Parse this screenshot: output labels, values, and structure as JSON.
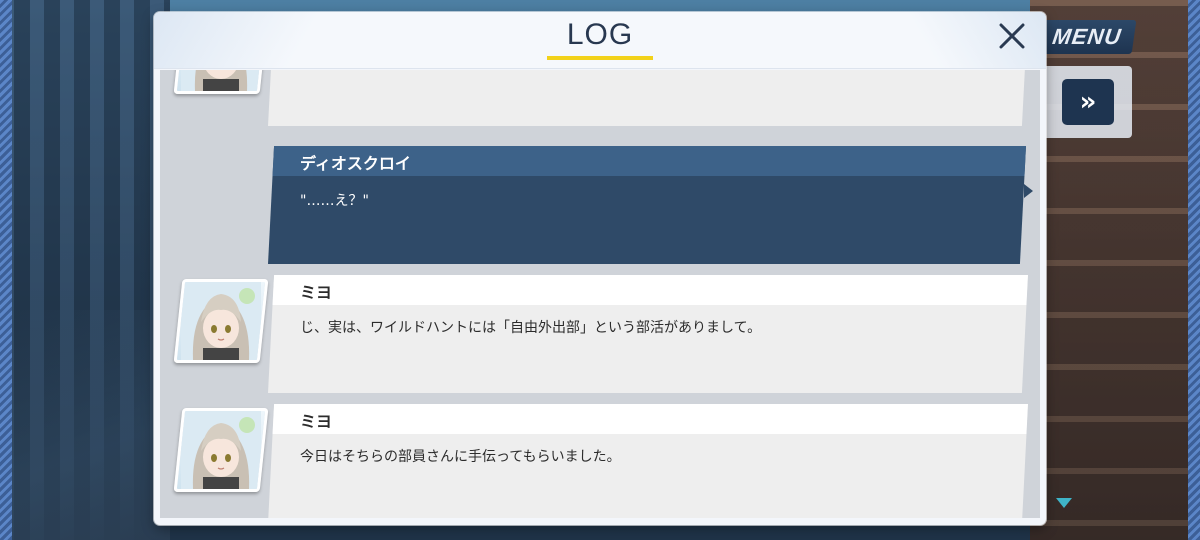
{
  "hud": {
    "menu_label": "MENU",
    "skip_symbol": "»"
  },
  "log": {
    "title": "LOG",
    "accent_color": "#f2d21a",
    "entries": [
      {
        "speaker": "",
        "text": "",
        "style": "light",
        "has_avatar": true
      },
      {
        "speaker": "ディオスクロイ",
        "text": "\"……え？\"",
        "style": "dark",
        "has_avatar": false
      },
      {
        "speaker": "ミヨ",
        "text": "じ、実は、ワイルドハントには「自由外出部」という部活がありまして。",
        "style": "light",
        "has_avatar": true
      },
      {
        "speaker": "ミヨ",
        "text": "今日はそちらの部員さんに手伝ってもらいました。",
        "style": "light",
        "has_avatar": true
      }
    ]
  }
}
